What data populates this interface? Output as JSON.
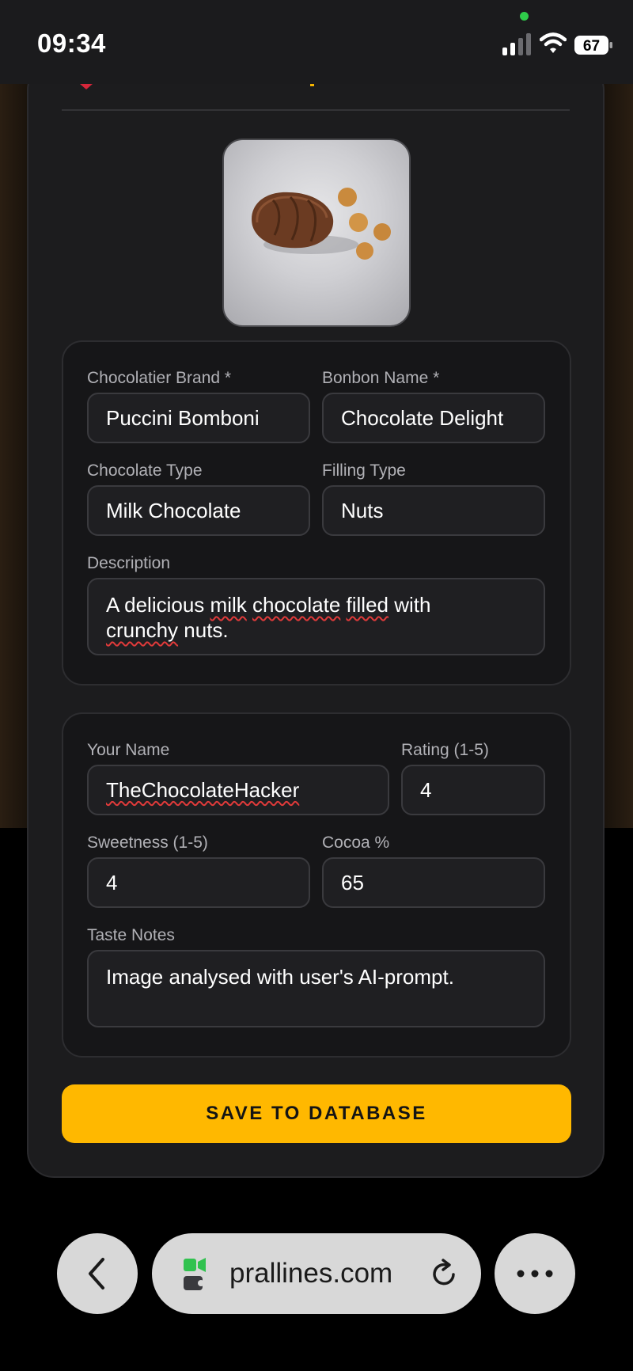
{
  "status_bar": {
    "time": "09:34",
    "battery": "67"
  },
  "form": {
    "brand": {
      "label": "Chocolatier Brand *",
      "value": "Puccini Bomboni"
    },
    "bonbon": {
      "label": "Bonbon Name *",
      "value": "Chocolate Delight"
    },
    "chocolate_type": {
      "label": "Chocolate Type",
      "value": "Milk Chocolate"
    },
    "filling_type": {
      "label": "Filling Type",
      "value": "Nuts"
    },
    "description": {
      "label": "Description",
      "parts": [
        "A delicious ",
        "milk",
        " ",
        "chocolate",
        " ",
        "filled",
        " with",
        "crunchy",
        " nuts."
      ]
    },
    "your_name": {
      "label": "Your Name",
      "value": "TheChocolateHacker"
    },
    "rating": {
      "label": "Rating (1-5)",
      "value": "4"
    },
    "sweetness": {
      "label": "Sweetness (1-5)",
      "value": "4"
    },
    "cocoa": {
      "label": "Cocoa %",
      "value": "65"
    },
    "taste_notes": {
      "label": "Taste Notes",
      "value": "Image analysed with  user's AI-prompt."
    }
  },
  "save_button": {
    "label": "SAVE TO DATABASE"
  },
  "browser": {
    "url": "prallines.com"
  },
  "icons": {
    "back": "chevron-left-icon",
    "more": "ellipsis-icon",
    "reload": "reload-icon",
    "site": "site-info-icon",
    "signal": "cellular-signal-icon",
    "wifi": "wifi-icon",
    "battery": "battery-icon"
  },
  "colors": {
    "accent": "#ffb800",
    "card": "#1c1c1e",
    "field": "#1f1f22",
    "spellcheck": "#e03a3a"
  }
}
